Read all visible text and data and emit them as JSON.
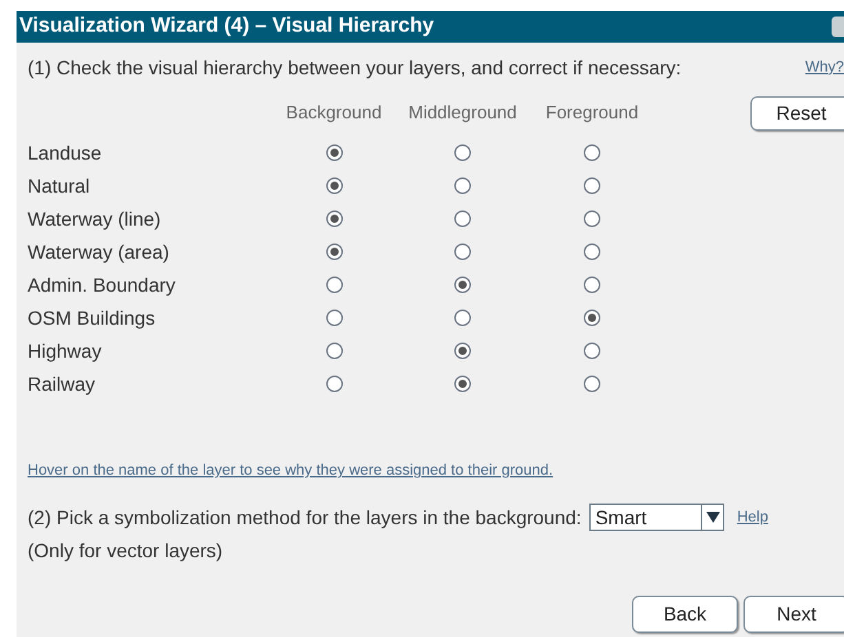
{
  "window": {
    "title": "Visualization Wizard (4) – Visual Hierarchy"
  },
  "step1": {
    "text": "(1) Check the visual hierarchy between your layers, and correct if necessary:",
    "link": "Why?"
  },
  "columns": [
    "Background",
    "Middleground",
    "Foreground"
  ],
  "reset_button": "Reset",
  "layers": [
    {
      "name": "Landuse",
      "grounds": [
        {
          "selected": true
        },
        {
          "selected": false
        },
        {
          "selected": false
        }
      ]
    },
    {
      "name": "Natural",
      "grounds": [
        {
          "selected": true
        },
        {
          "selected": false
        },
        {
          "selected": false
        }
      ]
    },
    {
      "name": "Waterway (line)",
      "grounds": [
        {
          "selected": true
        },
        {
          "selected": false
        },
        {
          "selected": false
        }
      ]
    },
    {
      "name": "Waterway (area)",
      "grounds": [
        {
          "selected": true
        },
        {
          "selected": false
        },
        {
          "selected": false
        }
      ]
    },
    {
      "name": "Admin. Boundary",
      "grounds": [
        {
          "selected": false
        },
        {
          "selected": true
        },
        {
          "selected": false
        }
      ]
    },
    {
      "name": "OSM Buildings",
      "grounds": [
        {
          "selected": false
        },
        {
          "selected": false
        },
        {
          "selected": true
        }
      ]
    },
    {
      "name": "Highway",
      "grounds": [
        {
          "selected": false
        },
        {
          "selected": true
        },
        {
          "selected": false
        }
      ]
    },
    {
      "name": "Railway",
      "grounds": [
        {
          "selected": false
        },
        {
          "selected": true
        },
        {
          "selected": false
        }
      ]
    }
  ],
  "hover_hint": "Hover on the name of the layer to see why they were assigned to their ground.",
  "step2": {
    "text": "(2) Pick a symbolization method for the layers in the background:",
    "value": "Smart",
    "link": "Help",
    "note": "(Only for vector layers)"
  },
  "buttons": [
    "Back",
    "Next"
  ]
}
